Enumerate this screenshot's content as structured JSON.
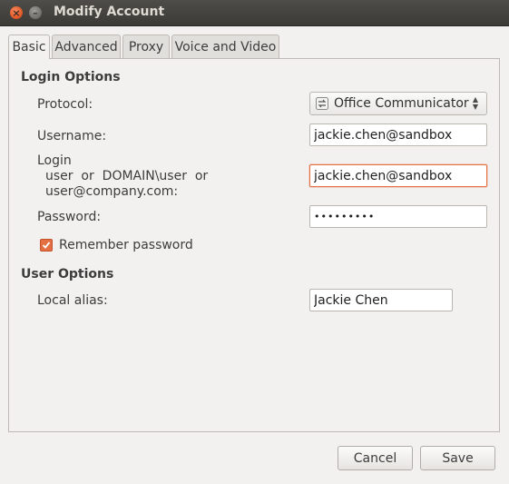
{
  "window": {
    "title": "Modify Account"
  },
  "tabs": [
    {
      "label": "Basic",
      "active": true
    },
    {
      "label": "Advanced",
      "active": false
    },
    {
      "label": "Proxy",
      "active": false
    },
    {
      "label": "Voice and Video",
      "active": false
    }
  ],
  "login_options": {
    "heading": "Login Options",
    "protocol_label": "Protocol:",
    "protocol_value": "Office Communicator",
    "username_label": "Username:",
    "username_value": "jackie.chen@sandbox",
    "login_label_line1": "Login",
    "login_label_line2": "user  or  DOMAIN\\user  or",
    "login_label_line3": "user@company.com:",
    "login_value": "jackie.chen@sandbox",
    "password_label": "Password:",
    "password_value": "•••••••••",
    "remember_label": "Remember password",
    "remember_checked": true
  },
  "user_options": {
    "heading": "User Options",
    "alias_label": "Local alias:",
    "alias_value": "Jackie Chen"
  },
  "buttons": {
    "cancel": "Cancel",
    "save": "Save"
  },
  "colors": {
    "accent": "#e36f43",
    "titlebar": "#3c3b37"
  }
}
